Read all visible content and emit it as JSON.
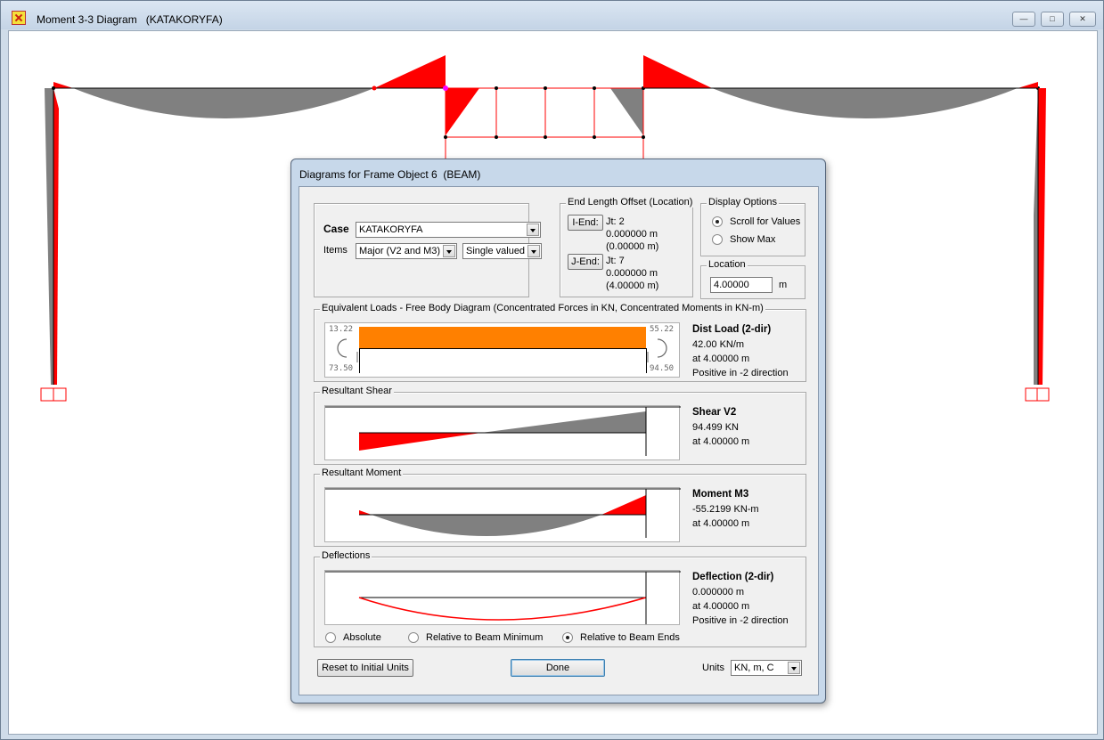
{
  "window": {
    "title": "Moment 3-3 Diagram   (KATAKORYFA)",
    "minimize": "—",
    "maximize": "□",
    "close": "✕"
  },
  "dialog": {
    "title": "Diagrams for Frame Object 6  (BEAM)",
    "case_label": "Case",
    "case_value": "KATAKORYFA",
    "items_label": "Items",
    "items_value": "Major (V2 and M3)",
    "items_mode": "Single valued",
    "end_offset": {
      "label": "End Length Offset (Location)",
      "i_end": "I-End:",
      "i_jt": "Jt:  2",
      "i_val1": "0.000000 m",
      "i_val2": "(0.00000 m)",
      "j_end": "J-End:",
      "j_jt": "Jt:  7",
      "j_val1": "0.000000 m",
      "j_val2": "(4.00000 m)"
    },
    "display_options": {
      "label": "Display Options",
      "scroll": "Scroll for Values",
      "show_max": "Show Max"
    },
    "location": {
      "label": "Location",
      "value": "4.00000",
      "unit": "m"
    },
    "equiv_loads": {
      "label": "Equivalent Loads - Free Body Diagram  (Concentrated Forces in KN, Concentrated Moments in KN-m)",
      "left_top": "13.22",
      "left_bottom": "73.50",
      "right_top": "55.22",
      "right_bottom": "94.50",
      "title": "Dist Load (2-dir)",
      "line1": "42.00 KN/m",
      "line2": "at 4.00000 m",
      "line3": "Positive in -2 direction",
      "fill_color": "#ff8000"
    },
    "shear": {
      "label": "Resultant Shear",
      "title": "Shear V2",
      "line1": "94.499 KN",
      "line2": "at 4.00000 m"
    },
    "moment": {
      "label": "Resultant Moment",
      "title": "Moment M3",
      "line1": "-55.2199 KN-m",
      "line2": "at 4.00000 m"
    },
    "deflection": {
      "label": "Deflections",
      "title": "Deflection (2-dir)",
      "line1": "0.000000 m",
      "line2": "at 4.00000 m",
      "line3": "Positive in -2 direction",
      "absolute": "Absolute",
      "rel_min": "Relative to Beam Minimum",
      "rel_ends": "Relative to Beam Ends"
    },
    "reset_button": "Reset to Initial Units",
    "done_button": "Done",
    "units_label": "Units",
    "units_value": "KN, m, C"
  },
  "colors": {
    "negative": "#ff0000",
    "positive": "#808080"
  }
}
